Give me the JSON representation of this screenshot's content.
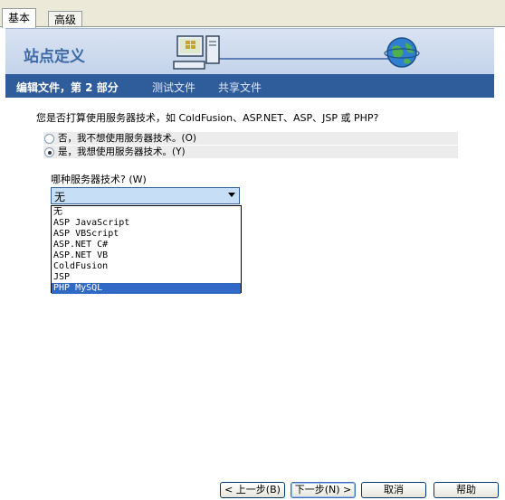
{
  "tabs": [
    "基本",
    "高级"
  ],
  "banner": {
    "title": "站点定义"
  },
  "subnav": {
    "active": "编辑文件，第 2 部分",
    "items": [
      "测试文件",
      "共享文件"
    ]
  },
  "question": "您是否打算使用服务器技术，如 ColdFusion、ASP.NET、ASP、JSP 或 PHP?",
  "radios": [
    {
      "label": "否，我不想使用服务器技术。(O)",
      "checked": false
    },
    {
      "label": "是，我想使用服务器技术。(Y)",
      "checked": true
    }
  ],
  "server_tech": {
    "label": "哪种服务器技术? (W)",
    "selected_display": "无",
    "options": [
      "无",
      "ASP JavaScript",
      "ASP VBScript",
      "ASP.NET C#",
      "ASP.NET VB",
      "ColdFusion",
      "JSP",
      "PHP MySQL"
    ],
    "highlighted": "PHP MySQL"
  },
  "buttons": {
    "back": "< 上一步(B)",
    "next": "下一步(N) >",
    "cancel": "取消",
    "help": "帮助"
  },
  "colors": {
    "banner_title": "#3e6aa6",
    "subnav_bg": "#2f5d9c",
    "selection": "#3169c6"
  }
}
